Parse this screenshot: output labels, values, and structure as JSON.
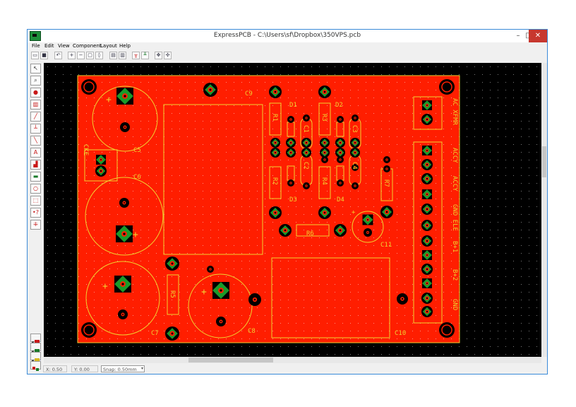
{
  "window": {
    "title": "ExpressPCB - C:\\Users\\sf\\Dropbox\\350VPS.pcb",
    "controls": {
      "minimize": "–",
      "maximize": "□",
      "close": "✕"
    }
  },
  "menu": {
    "items": [
      "File",
      "Edit",
      "View",
      "Component",
      "Layout",
      "Help"
    ]
  },
  "toolbar": {
    "buttons": [
      "open-icon",
      "save-icon",
      "undo-icon",
      "zoom-in-icon",
      "zoom-out-icon",
      "zoom-area-icon",
      "zoom-fit-icon",
      "print-icon",
      "print-preview-icon",
      "pad-top-icon",
      "pad-bottom-icon",
      "move-icon",
      "rotate-icon"
    ]
  },
  "sidebar": {
    "tools": [
      "pointer-icon",
      "zoom-tool-icon",
      "place-pad-icon",
      "place-component-icon",
      "trace-icon",
      "trace-corner-icon",
      "diagonal-trace-icon",
      "text-icon",
      "filled-shape-icon",
      "rectangle-icon",
      "circle-icon",
      "board-outline-icon",
      "pad-select-icon",
      "measure-icon"
    ],
    "layers": [
      "layer-top-icon",
      "layer-bottom-icon",
      "layer-silk-icon",
      "layer-toggle-icon"
    ]
  },
  "board": {
    "colors": {
      "copper": "#ff1e00",
      "silkscreen": "#f0d030",
      "pad_green": "#1a9a2a",
      "background": "#000000"
    },
    "labels": {
      "c9": "C9",
      "c5": "C5",
      "c6": "C6",
      "c7": "C7",
      "c8": "C8",
      "c10": "C10",
      "c11": "C11",
      "cke": "CKE",
      "r1": "R1",
      "r2": "R2",
      "r3": "R3",
      "r4": "R4",
      "r5": "R5",
      "r6": "R6",
      "r7": "R7",
      "d1": "D1",
      "d2": "D2",
      "d3": "D3",
      "d4": "D4",
      "c1": "C1",
      "c2": "C2",
      "c3": "C3",
      "c4": "C4",
      "ac_xfmr": "AC XFMR",
      "accy1": "ACCY",
      "accy2": "ACCY",
      "gnd_ele": "GND ELE",
      "b1": "B+1",
      "b2": "B+2",
      "gnd": "GND",
      "plus": "+"
    }
  },
  "status": {
    "x": "X: 0.50",
    "y": "Y: 0.00",
    "snap": "Snap: 0.50mm"
  }
}
